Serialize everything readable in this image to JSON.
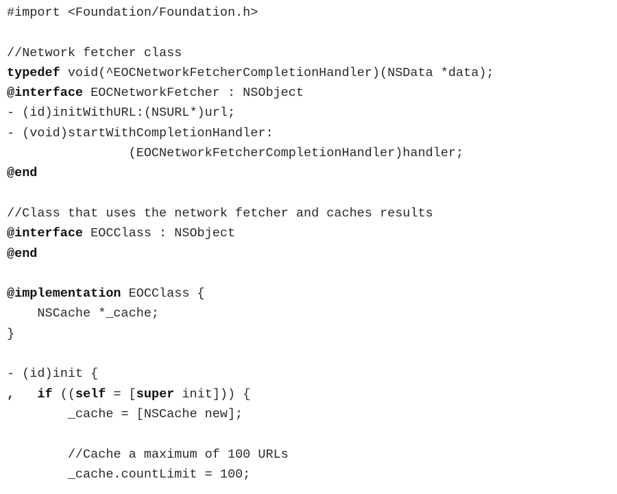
{
  "lines": [
    {
      "id": "import",
      "segments": [
        {
          "text": "#import <Foundation/Foundation.h>",
          "style": "plain"
        }
      ]
    },
    {
      "id": "blank-1",
      "segments": []
    },
    {
      "id": "comment-network",
      "segments": [
        {
          "text": "//Network fetcher class",
          "style": "comment"
        }
      ]
    },
    {
      "id": "typedef",
      "segments": [
        {
          "text": "typedef",
          "style": "keyword"
        },
        {
          "text": " void(^EOCNetworkFetcherCompletionHandler)(NSData *data);",
          "style": "plain"
        }
      ]
    },
    {
      "id": "interface-fetcher",
      "segments": [
        {
          "text": "@interface",
          "style": "keyword"
        },
        {
          "text": " EOCNetworkFetcher : NSObject",
          "style": "plain"
        }
      ]
    },
    {
      "id": "method-init-url",
      "segments": [
        {
          "text": "- (id)initWithURL:(NSURL*)url;",
          "style": "plain"
        }
      ]
    },
    {
      "id": "method-start",
      "segments": [
        {
          "text": "- (void)startWithCompletionHandler:",
          "style": "plain"
        }
      ]
    },
    {
      "id": "method-start-cont",
      "segments": [
        {
          "text": "                (EOCNetworkFetcherCompletionHandler)handler;",
          "style": "plain"
        }
      ]
    },
    {
      "id": "end-1",
      "segments": [
        {
          "text": "@end",
          "style": "keyword"
        }
      ]
    },
    {
      "id": "blank-2",
      "segments": []
    },
    {
      "id": "comment-class",
      "segments": [
        {
          "text": "//Class that uses the network fetcher and caches results",
          "style": "comment"
        }
      ]
    },
    {
      "id": "interface-class",
      "segments": [
        {
          "text": "@interface",
          "style": "keyword"
        },
        {
          "text": " EOCClass : NSObject",
          "style": "plain"
        }
      ]
    },
    {
      "id": "end-2",
      "segments": [
        {
          "text": "@end",
          "style": "keyword"
        }
      ]
    },
    {
      "id": "blank-3",
      "segments": []
    },
    {
      "id": "implementation",
      "segments": [
        {
          "text": "@implementation",
          "style": "keyword"
        },
        {
          "text": " EOCClass {",
          "style": "plain"
        }
      ]
    },
    {
      "id": "ivar-cache",
      "segments": [
        {
          "text": "    NSCache *_cache;",
          "style": "plain"
        }
      ]
    },
    {
      "id": "close-brace",
      "segments": [
        {
          "text": "}",
          "style": "plain"
        }
      ]
    },
    {
      "id": "blank-4",
      "segments": []
    },
    {
      "id": "method-init",
      "segments": [
        {
          "text": "- (id)init {",
          "style": "plain"
        }
      ]
    },
    {
      "id": "if-self",
      "margin_mark": ",",
      "segments": [
        {
          "text": "    ",
          "style": "plain"
        },
        {
          "text": "if",
          "style": "keyword"
        },
        {
          "text": " ((",
          "style": "plain"
        },
        {
          "text": "self",
          "style": "keyword"
        },
        {
          "text": " = [",
          "style": "plain"
        },
        {
          "text": "super",
          "style": "keyword"
        },
        {
          "text": " init])) {",
          "style": "plain"
        }
      ]
    },
    {
      "id": "cache-new",
      "segments": [
        {
          "text": "        _cache = [NSCache new];",
          "style": "plain"
        }
      ]
    },
    {
      "id": "blank-5",
      "segments": []
    },
    {
      "id": "comment-limit",
      "segments": [
        {
          "text": "        ",
          "style": "plain"
        },
        {
          "text": "//Cache a maximum of 100 URLs",
          "style": "comment"
        }
      ]
    },
    {
      "id": "count-limit",
      "segments": [
        {
          "text": "        _cache.countLimit = 100;",
          "style": "plain"
        }
      ]
    }
  ]
}
